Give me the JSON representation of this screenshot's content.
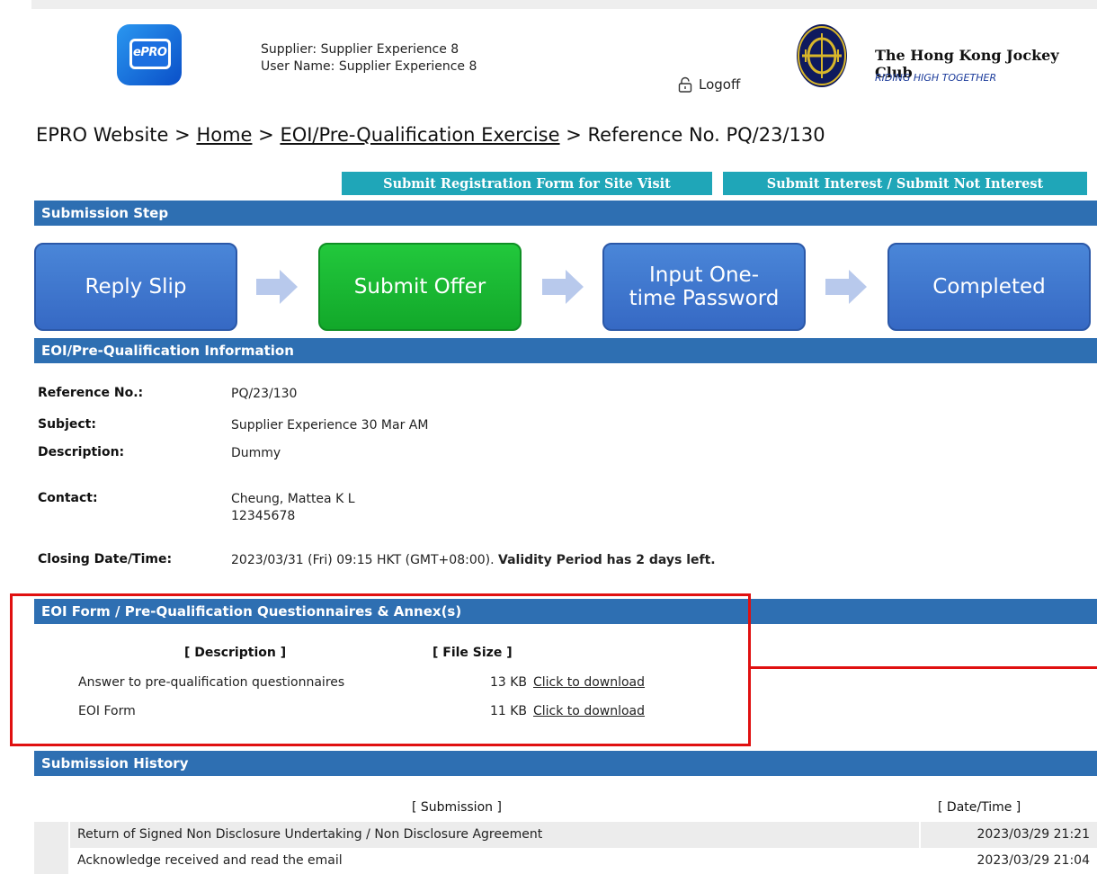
{
  "header": {
    "supplier": "Supplier: Supplier Experience 8",
    "username": "User Name: Supplier Experience 8",
    "logoff_label": "Logoff",
    "logo_text": "ePRO",
    "org_name": "The Hong Kong Jockey Club",
    "org_motto": "RIDING HIGH TOGETHER"
  },
  "breadcrumb": {
    "root": "EPRO Website",
    "home": "Home",
    "exercise": "EOI/Pre-Qualification Exercise",
    "current": "Reference No. PQ/23/130",
    "separator": ">"
  },
  "actions": {
    "site_visit": "Submit Registration Form for Site Visit",
    "interest": "Submit Interest / Submit Not Interest"
  },
  "steps": {
    "section_title": "Submission Step",
    "items": [
      {
        "label": "Reply Slip",
        "state": "default"
      },
      {
        "label": "Submit Offer",
        "state": "active"
      },
      {
        "label_line1": "Input One-",
        "label_line2": "time Password",
        "state": "default"
      },
      {
        "label": "Completed",
        "state": "default"
      }
    ]
  },
  "info": {
    "section_title": "EOI/Pre-Qualification Information",
    "reference_label": "Reference No.:",
    "reference_value": "PQ/23/130",
    "subject_label": "Subject:",
    "subject_value": "Supplier Experience 30 Mar AM",
    "description_label": "Description:",
    "description_value": "Dummy",
    "contact_label": "Contact:",
    "contact_name": "Cheung, Mattea K L",
    "contact_phone": "12345678",
    "closing_label": "Closing Date/Time:",
    "closing_value": "2023/03/31 (Fri) 09:15 HKT (GMT+08:00).",
    "validity_note": "Validity Period has 2 days left."
  },
  "annex": {
    "section_title": "EOI Form / Pre-Qualification Questionnaires & Annex(s)",
    "col_description": "[ Description ]",
    "col_filesize": "[ File Size ]",
    "rows": [
      {
        "description": "Answer to pre-qualification questionnaires",
        "size": "13 KB",
        "link": "Click to download"
      },
      {
        "description": "EOI Form",
        "size": "11 KB",
        "link": "Click to download"
      }
    ]
  },
  "history": {
    "section_title": "Submission History",
    "col_submission": "[ Submission ]",
    "col_datetime": "[ Date/Time ]",
    "rows": [
      {
        "submission": "Return of Signed Non Disclosure Undertaking / Non Disclosure Agreement",
        "datetime": "2023/03/29 21:21"
      },
      {
        "submission": "Acknowledge received and read the email",
        "datetime": "2023/03/29 21:04"
      }
    ]
  },
  "colors": {
    "section_bar": "#2e6fb2",
    "teal_button": "#1fa6b8",
    "step_blue": "#3f78cf",
    "step_green": "#18b832",
    "highlight_red": "#e01010"
  }
}
